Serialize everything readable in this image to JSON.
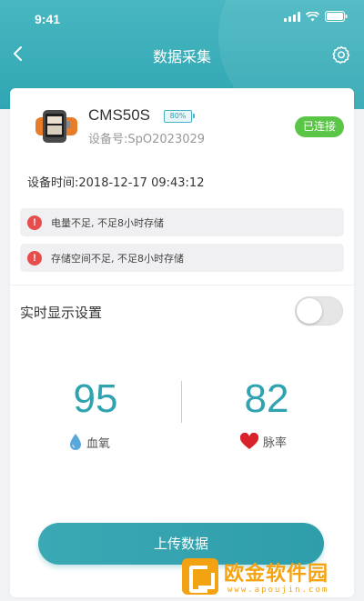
{
  "status_bar": {
    "time": "9:41"
  },
  "nav": {
    "title": "数据采集"
  },
  "device": {
    "name": "CMS50S",
    "battery": "80%",
    "id_label": "设备号:",
    "id_value": "SpO2023029",
    "status": "已连接",
    "time_label": "设备时间:",
    "time_value": "2018-12-17 09:43:12"
  },
  "alerts": [
    {
      "icon": "!",
      "text": "电量不足, 不足8小时存储"
    },
    {
      "icon": "!",
      "text": "存储空间不足, 不足8小时存储"
    }
  ],
  "realtime": {
    "label": "实时显示设置",
    "enabled": false
  },
  "metrics": [
    {
      "value": "95",
      "label": "血氧",
      "icon": "water-drop-icon"
    },
    {
      "value": "82",
      "label": "脉率",
      "icon": "heart-icon"
    }
  ],
  "upload_button": "上传数据",
  "watermark": {
    "title": "欧金软件园",
    "url": "www.apoujin.com"
  },
  "colors": {
    "accent": "#2fa3b0",
    "connected": "#5bc548",
    "warning": "#e84d4d",
    "watermark": "#f4a313"
  }
}
